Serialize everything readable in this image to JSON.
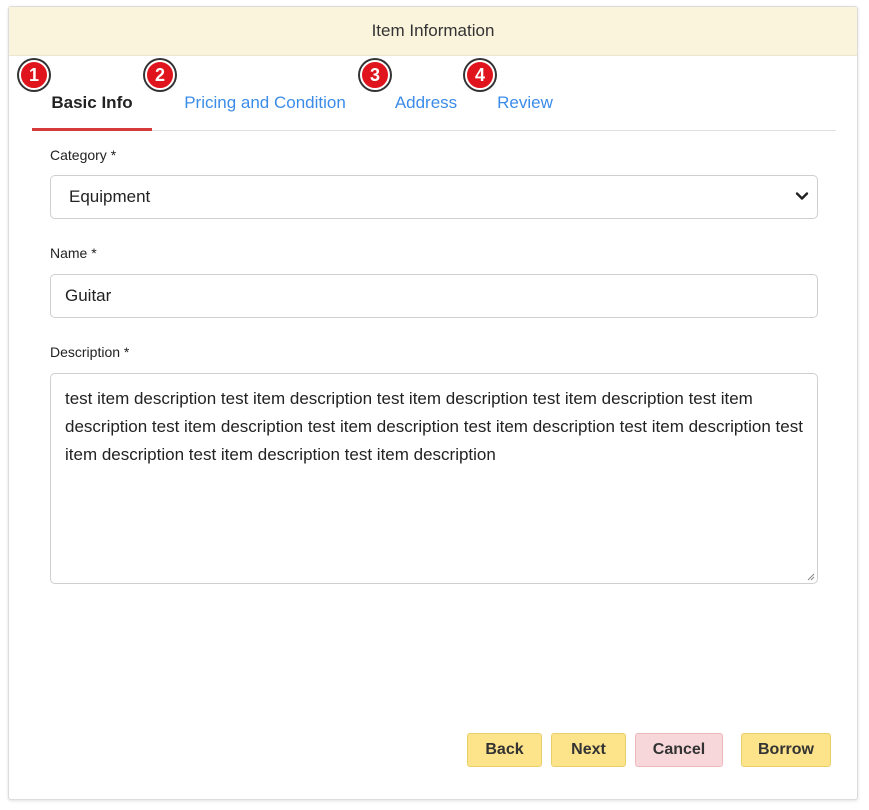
{
  "header": {
    "title": "Item Information"
  },
  "tabs": [
    {
      "badge": "1",
      "label": "Basic Info",
      "active": true
    },
    {
      "badge": "2",
      "label": "Pricing and Condition",
      "active": false
    },
    {
      "badge": "3",
      "label": "Address",
      "active": false
    },
    {
      "badge": "4",
      "label": "Review",
      "active": false
    }
  ],
  "form": {
    "category": {
      "label": "Category *",
      "value": "Equipment"
    },
    "name": {
      "label": "Name *",
      "value": "Guitar"
    },
    "description": {
      "label": "Description *",
      "value": "test item description test item description test item description test item description test item description test item description test item description test item description test item description test item description test item description test item description"
    }
  },
  "buttons": {
    "back": "Back",
    "next": "Next",
    "cancel": "Cancel",
    "borrow": "Borrow"
  },
  "colors": {
    "header_bg": "#fbf4dd",
    "accent_link": "#3b8ce8",
    "active_underline": "#d43a3a",
    "badge": "#e0141c",
    "button_yellow": "#fde38a",
    "button_pink": "#f8d7da"
  }
}
